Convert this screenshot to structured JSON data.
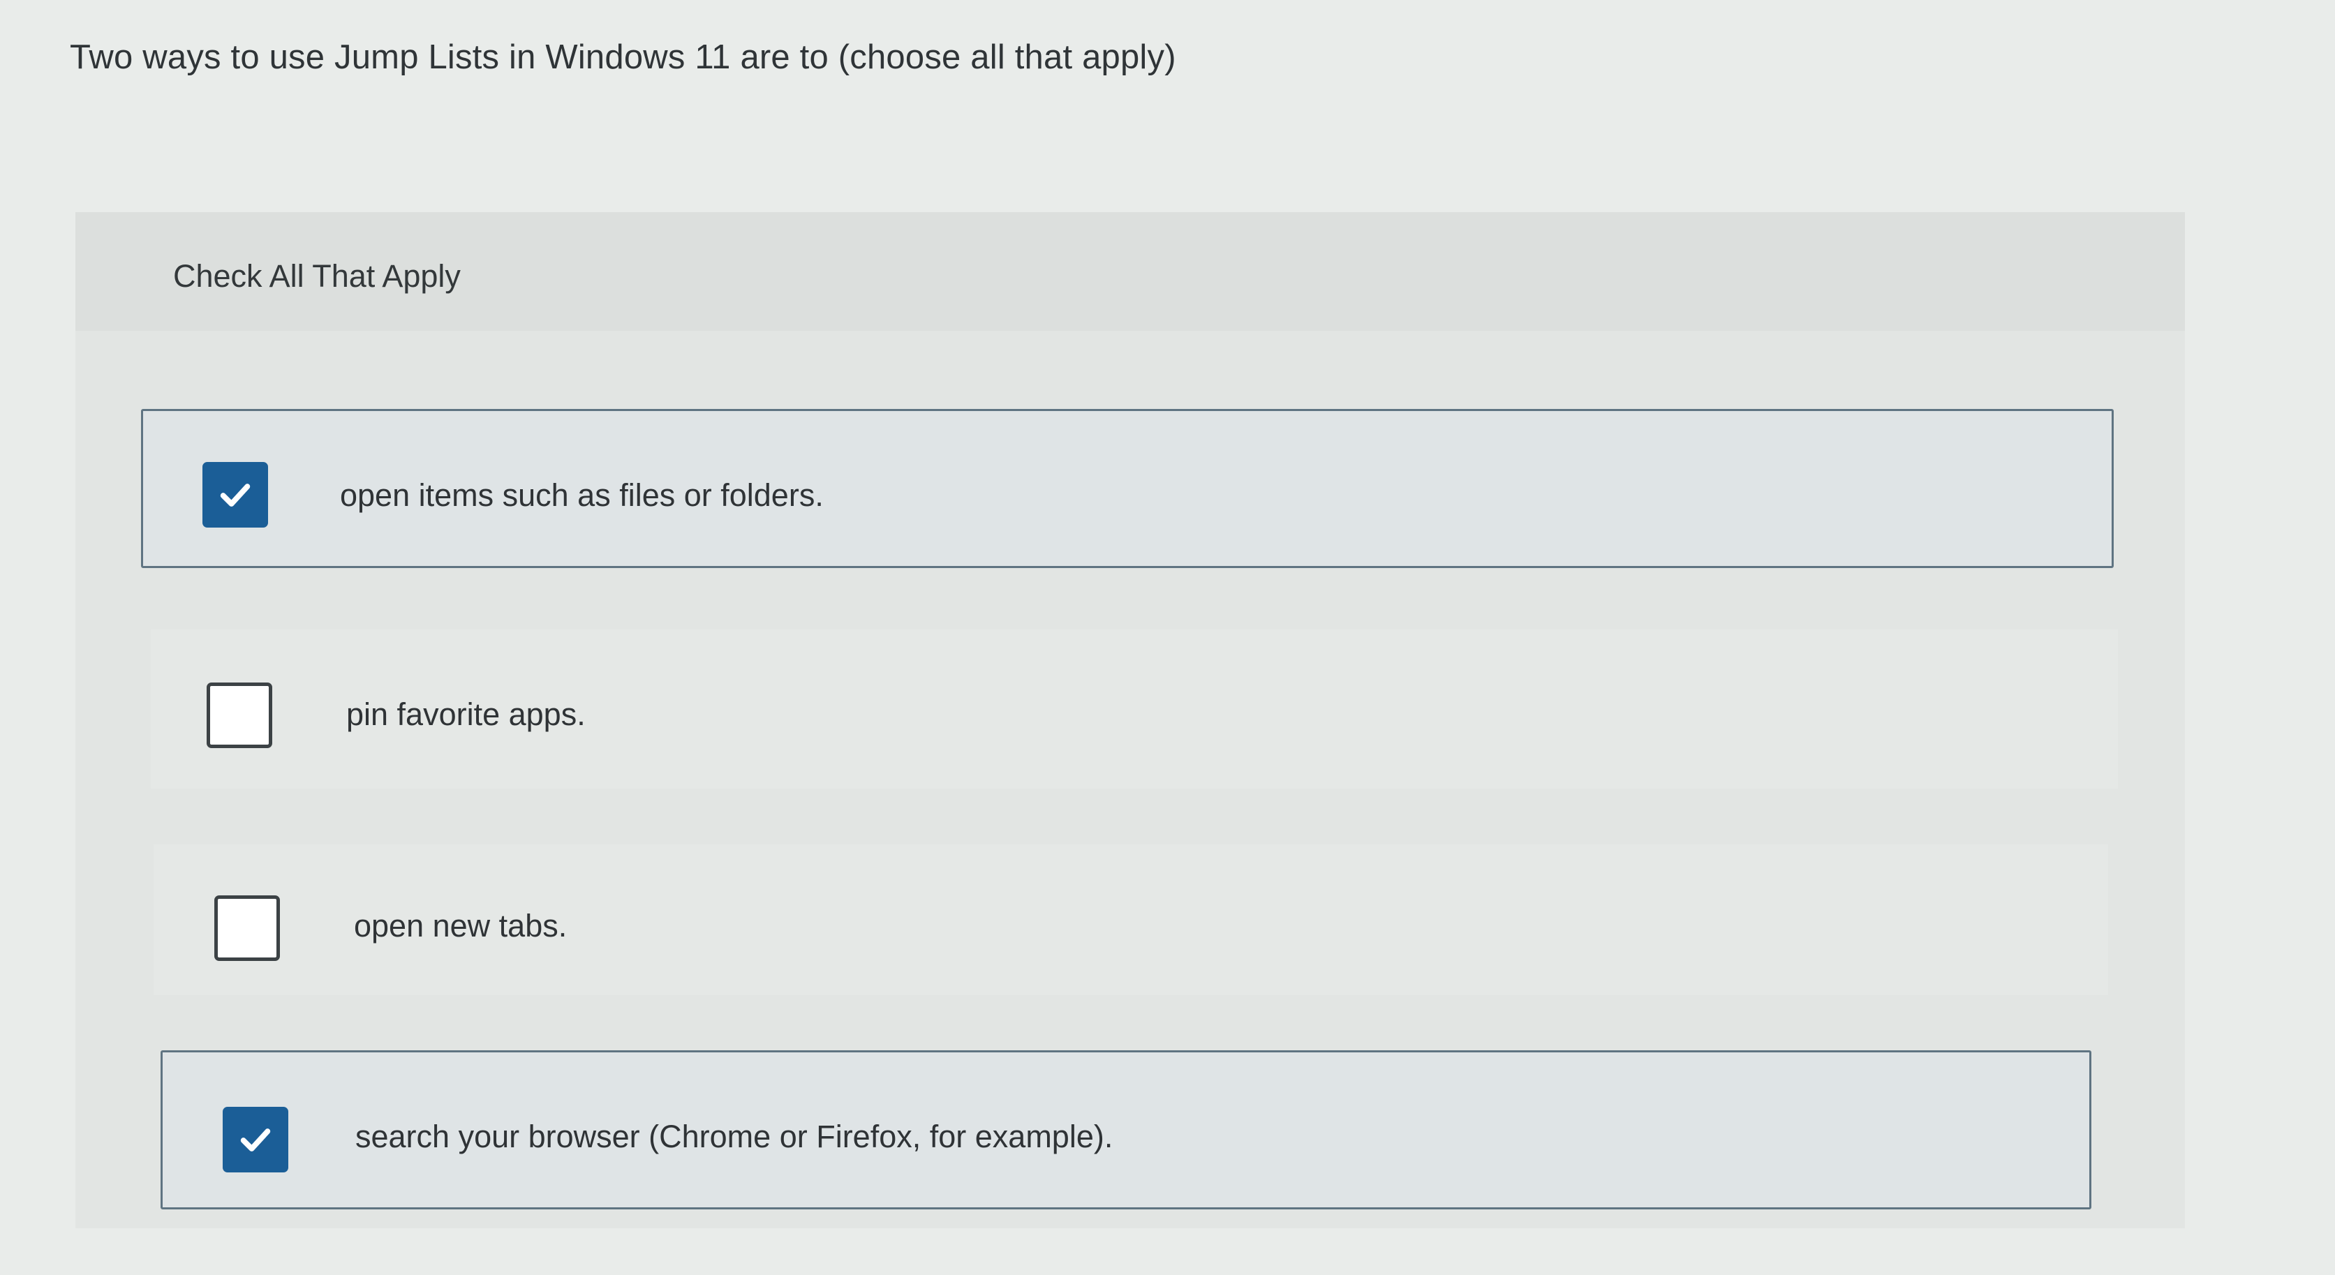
{
  "question": "Two ways to use Jump Lists in Windows 11 are to (choose all that apply)",
  "instructions": "Check All That Apply",
  "options": [
    {
      "label": "open items such as files or folders.",
      "checked": true
    },
    {
      "label": "pin favorite apps.",
      "checked": false
    },
    {
      "label": "open new tabs.",
      "checked": false
    },
    {
      "label": "search your browser (Chrome or Firefox, for example).",
      "checked": true
    }
  ],
  "colors": {
    "checked_fill": "#1b5e97",
    "selected_border": "#5f7482",
    "background": "#e9ecea"
  },
  "icons": {
    "checked": "checkmark-icon"
  }
}
